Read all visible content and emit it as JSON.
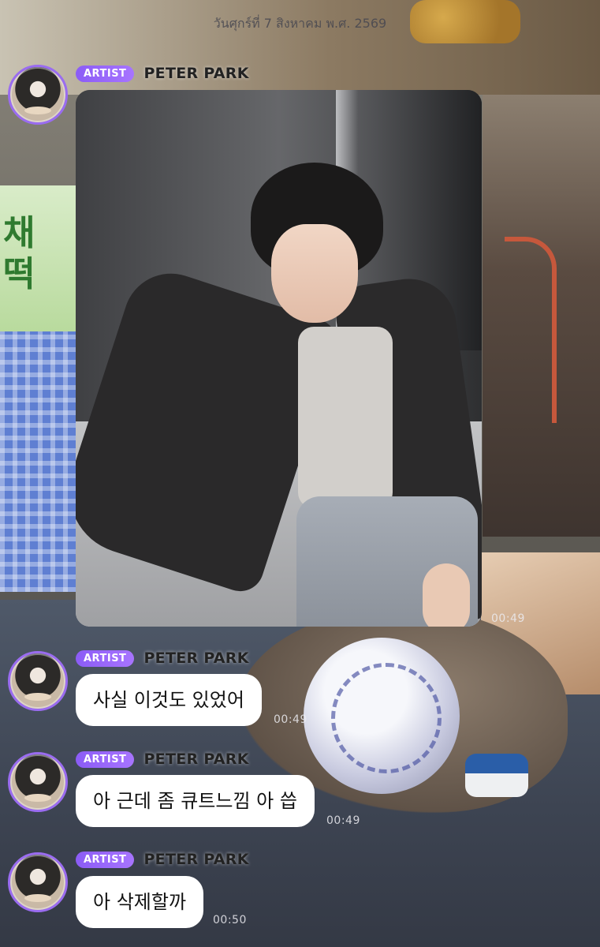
{
  "date_label": "วันศุกร์ที่ 7 สิงหาคม พ.ศ. 2569",
  "background_sign_text": "채 떡",
  "messages": [
    {
      "badge": "ARTIST",
      "author": "PETER PARK",
      "type": "image",
      "time": "00:49"
    },
    {
      "badge": "ARTIST",
      "author": "PETER PARK",
      "type": "text",
      "text": "사실 이것도 있었어",
      "time": "00:49"
    },
    {
      "badge": "ARTIST",
      "author": "PETER PARK",
      "type": "text",
      "text": "아 근데 좀 큐트느낌 아 씁",
      "time": "00:49"
    },
    {
      "badge": "ARTIST",
      "author": "PETER PARK",
      "type": "text",
      "text": "아 삭제할까",
      "time": "00:50"
    }
  ],
  "colors": {
    "badge": "#8b5cf6",
    "avatar_ring": "#9a6cf0",
    "bubble": "#ffffff"
  },
  "icons": [
    "avatar",
    "photo-message"
  ]
}
